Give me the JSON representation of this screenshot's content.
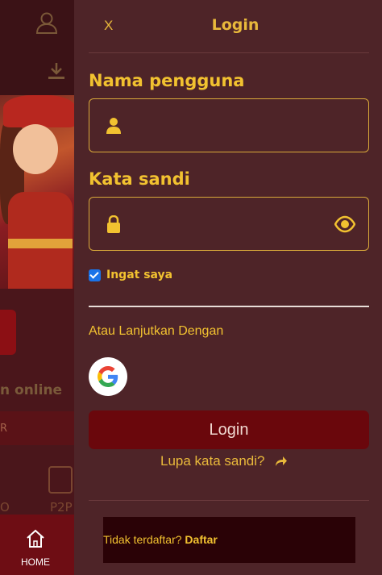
{
  "background": {
    "online_text": "n online",
    "strip_text": "R",
    "game_label_left": "O",
    "game_label_p2p": "P2P",
    "bottom_nav": {
      "home_label": "HOME",
      "icon": "home-icon"
    }
  },
  "login_drawer": {
    "close_label": "X",
    "title": "Login",
    "username": {
      "label": "Nama pengguna",
      "value": "",
      "placeholder": "",
      "icon": "user-icon"
    },
    "password": {
      "label": "Kata sandi",
      "value": "",
      "placeholder": "",
      "icon": "lock-icon",
      "toggle_icon": "eye-icon"
    },
    "remember_me": {
      "label": "Ingat saya",
      "checked": true
    },
    "alt_login_label": "Atau Lanjutkan Dengan",
    "google_icon": "google-icon",
    "login_button": "Login",
    "forgot_password": "Lupa kata sandi?",
    "register": {
      "prompt": "Tidak terdaftar?",
      "link": "Daftar"
    }
  },
  "colors": {
    "accent": "#f2c230",
    "drawer_bg": "#4e2428",
    "button_bg": "#6a070c",
    "nav_bg": "#6e0d14"
  }
}
